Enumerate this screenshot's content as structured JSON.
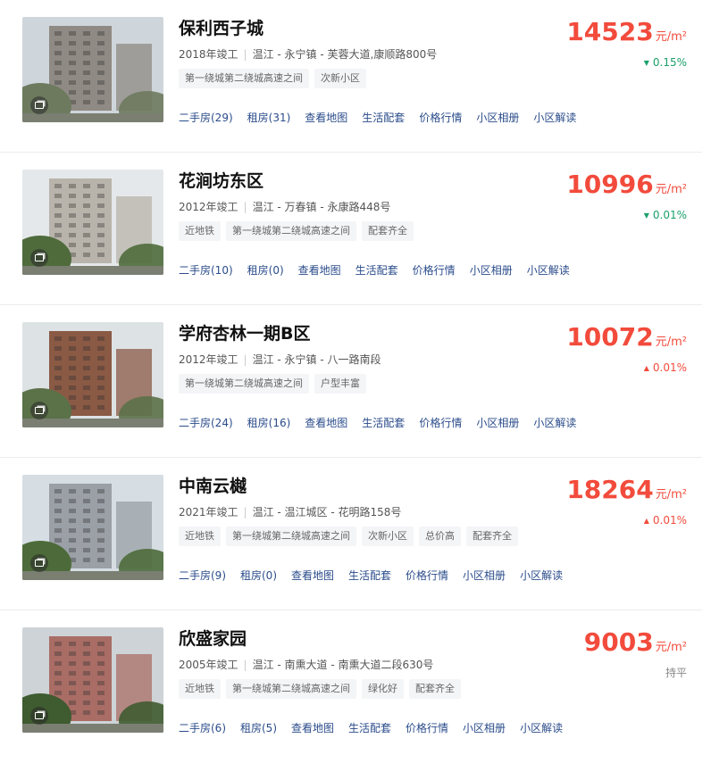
{
  "link_labels": {
    "map": "查看地图",
    "life": "生活配套",
    "trend": "价格行情",
    "album": "小区相册",
    "read": "小区解读"
  },
  "price_unit": "元/m²",
  "communities": [
    {
      "name": "保利西子城",
      "year": "2018年竣工",
      "location": "温江 - 永宁镇 - 芙蓉大道,康顺路800号",
      "tags": [
        "第一绕城第二绕城高速之间",
        "次新小区"
      ],
      "second_hand": "二手房(29)",
      "rent": "租房(31)",
      "price": "14523",
      "change": "0.15%",
      "trend": "down",
      "photo_colors": [
        "#cfd6db",
        "#8f8a84",
        "#6d7a5e"
      ]
    },
    {
      "name": "花涧坊东区",
      "year": "2012年竣工",
      "location": "温江 - 万春镇 - 永康路448号",
      "tags": [
        "近地铁",
        "第一绕城第二绕城高速之间",
        "配套齐全"
      ],
      "second_hand": "二手房(10)",
      "rent": "租房(0)",
      "price": "10996",
      "change": "0.01%",
      "trend": "down",
      "photo_colors": [
        "#e4e8ea",
        "#b9b4ab",
        "#4f6b3c"
      ]
    },
    {
      "name": "学府杏林一期B区",
      "year": "2012年竣工",
      "location": "温江 - 永宁镇 - 八一路南段",
      "tags": [
        "第一绕城第二绕城高速之间",
        "户型丰富"
      ],
      "second_hand": "二手房(24)",
      "rent": "租房(16)",
      "price": "10072",
      "change": "0.01%",
      "trend": "up",
      "photo_colors": [
        "#dde2e4",
        "#8a5a45",
        "#5b7148"
      ]
    },
    {
      "name": "中南云樾",
      "year": "2021年竣工",
      "location": "温江 - 温江城区 - 花明路158号",
      "tags": [
        "近地铁",
        "第一绕城第二绕城高速之间",
        "次新小区",
        "总价高",
        "配套齐全"
      ],
      "second_hand": "二手房(9)",
      "rent": "租房(0)",
      "price": "18264",
      "change": "0.01%",
      "trend": "up",
      "photo_colors": [
        "#d6dde3",
        "#9aa0a6",
        "#4d6b3a"
      ]
    },
    {
      "name": "欣盛家园",
      "year": "2005年竣工",
      "location": "温江 - 南熏大道 - 南熏大道二段630号",
      "tags": [
        "近地铁",
        "第一绕城第二绕城高速之间",
        "绿化好",
        "配套齐全"
      ],
      "second_hand": "二手房(6)",
      "rent": "租房(5)",
      "price": "9003",
      "change": "持平",
      "trend": "flat",
      "photo_colors": [
        "#cdd3d6",
        "#a96d66",
        "#3f5b30"
      ]
    }
  ]
}
